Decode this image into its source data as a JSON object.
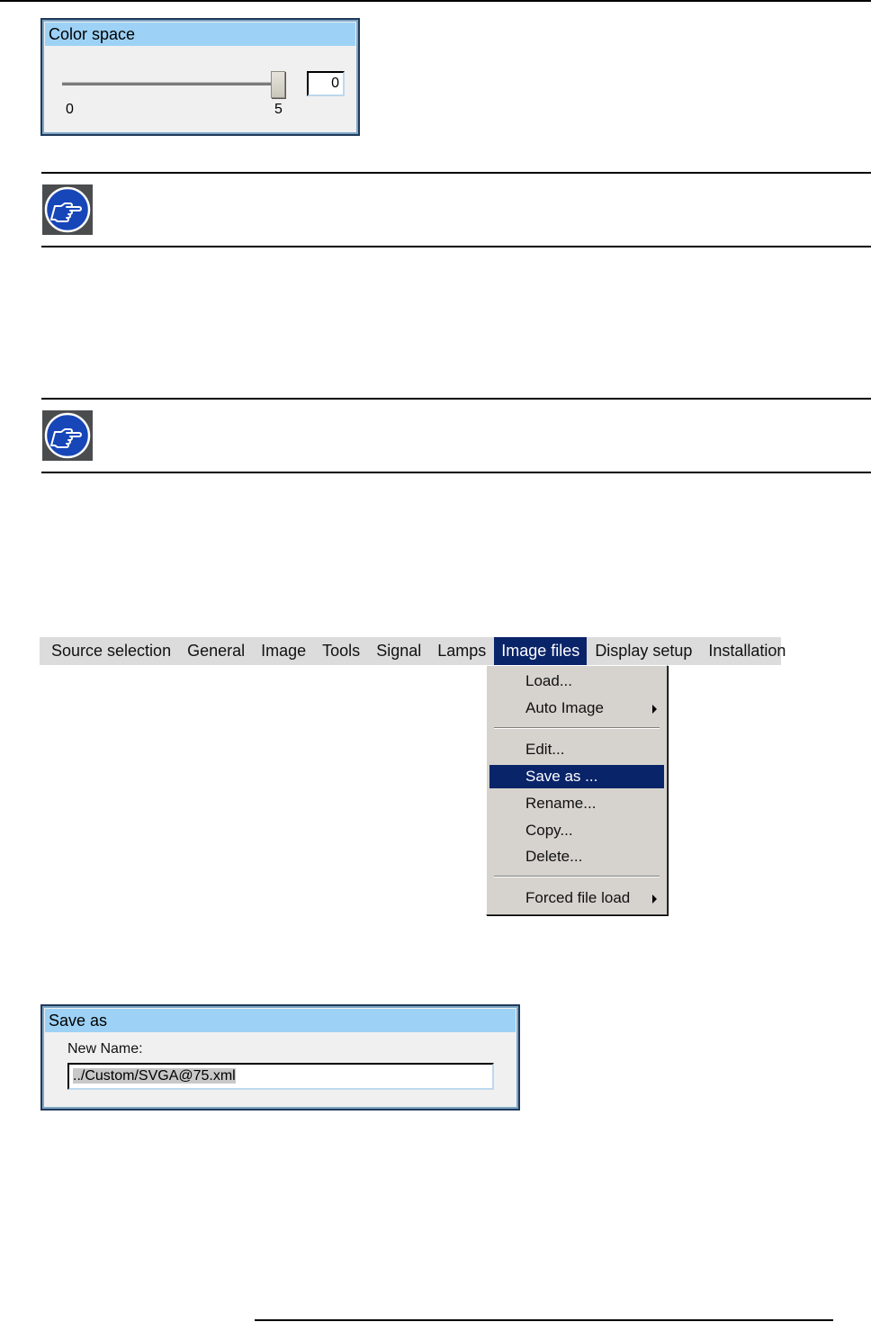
{
  "color_space_dialog": {
    "title": "Color space",
    "slider": {
      "min_label": "0",
      "max_label": "5",
      "value": 5
    },
    "value_box": "0"
  },
  "notes": [
    {
      "icon": "pointing-hand-icon"
    },
    {
      "icon": "pointing-hand-icon"
    }
  ],
  "menubar": {
    "items": [
      {
        "label": "Source selection"
      },
      {
        "label": "General"
      },
      {
        "label": "Image"
      },
      {
        "label": "Tools"
      },
      {
        "label": "Signal"
      },
      {
        "label": "Lamps"
      },
      {
        "label": "Image files",
        "active": true
      },
      {
        "label": "Display setup"
      },
      {
        "label": "Installation"
      }
    ]
  },
  "image_files_menu": {
    "items": [
      {
        "label": "Load..."
      },
      {
        "label": "Auto Image",
        "submenu": true
      },
      {
        "label": "Edit..."
      },
      {
        "label": "Save as ...",
        "selected": true
      },
      {
        "label": "Rename..."
      },
      {
        "label": "Copy..."
      },
      {
        "label": "Delete..."
      },
      {
        "label": "Forced file load",
        "submenu": true
      }
    ]
  },
  "save_as_dialog": {
    "title": "Save as",
    "field_label": "New Name:",
    "field_value": "../Custom/SVGA@75.xml"
  },
  "colors": {
    "title_bar": "#9dd2f6",
    "menu_highlight": "#0a246a",
    "menu_bg": "#dcdcdc",
    "dropdown_bg": "#d6d3ce",
    "note_icon_bg": "#4a4c4e"
  }
}
